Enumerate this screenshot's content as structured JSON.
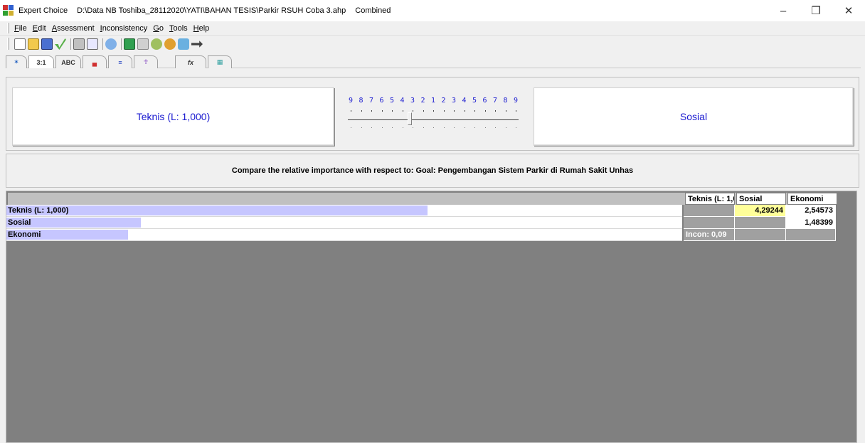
{
  "window": {
    "app_name": "Expert Choice",
    "file_path": "D:\\Data NB Toshiba_28112020\\YATI\\BAHAN TESIS\\Parkir RSUH Coba 3.ahp",
    "mode": "Combined",
    "minimize_glyph": "–",
    "restore_glyph": "❐",
    "close_glyph": "✕"
  },
  "menu": {
    "items": [
      {
        "accel": "F",
        "rest": "ile"
      },
      {
        "accel": "E",
        "rest": "dit"
      },
      {
        "accel": "A",
        "rest": "ssessment"
      },
      {
        "accel": "I",
        "rest": "nconsistency"
      },
      {
        "accel": "G",
        "rest": "o"
      },
      {
        "accel": "T",
        "rest": "ools"
      },
      {
        "accel": "H",
        "rest": "elp"
      }
    ]
  },
  "tabs": [
    "✶",
    "3:1",
    "ABC",
    "▄",
    "≡",
    "☥",
    "fx",
    "▦"
  ],
  "compare": {
    "left_node": "Teknis (L: 1,000)",
    "right_node": "Sosial",
    "scale_numbers": [
      "9",
      "8",
      "7",
      "6",
      "5",
      "4",
      "3",
      "2",
      "1",
      "2",
      "3",
      "4",
      "5",
      "6",
      "7",
      "8",
      "9"
    ],
    "slider_value": 4.29244
  },
  "question": "Compare the relative importance with respect to: Goal: Pengembangan Sistem Parkir di Rumah Sakit Unhas",
  "grid": {
    "headers": [
      "Teknis (L: 1,000)",
      "Sosial",
      "Ekonomi"
    ],
    "rows": [
      {
        "label": "Teknis (L: 1,000)",
        "bar_fraction": 0.623,
        "cells": [
          "",
          "4,29244",
          "2,54573"
        ]
      },
      {
        "label": "Sosial",
        "bar_fraction": 0.199,
        "cells": [
          "",
          "",
          "1,48399"
        ]
      },
      {
        "label": "Ekonomi",
        "bar_fraction": 0.18,
        "cells": [
          "Incon: 0,09",
          "",
          ""
        ]
      }
    ]
  },
  "colors": {
    "node_text": "#1a1ad0",
    "bar": "#c6c6ff",
    "selected_cell": "#ffff99",
    "grid_background": "#808080"
  }
}
